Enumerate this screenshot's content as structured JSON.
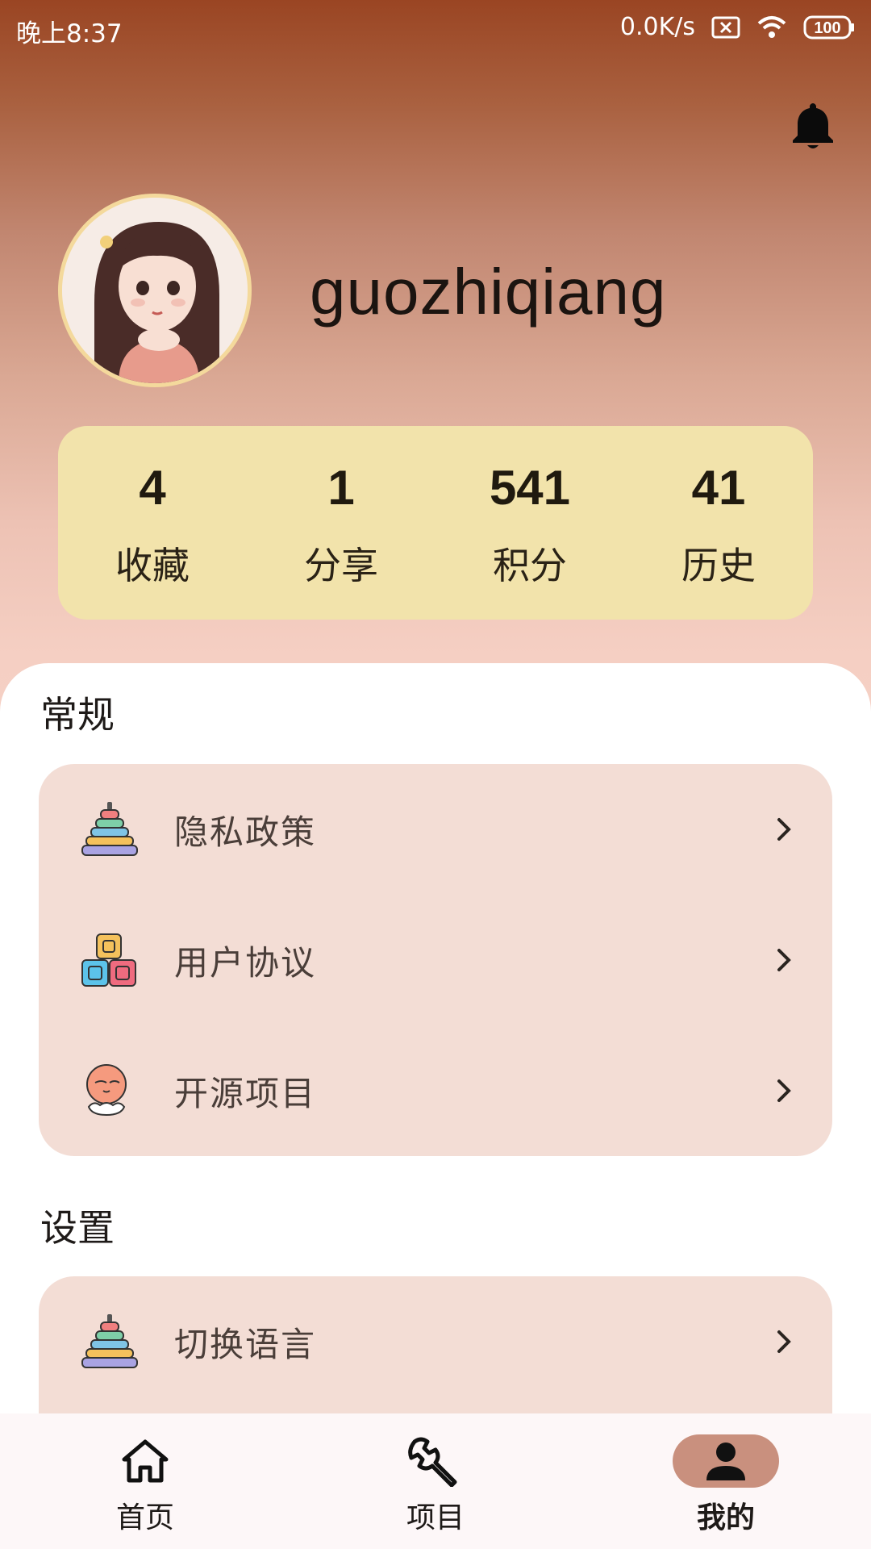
{
  "status_bar": {
    "time": "晚上8:37",
    "net_speed": "0.0K/s",
    "battery": "100"
  },
  "profile": {
    "username": "guozhiqiang",
    "stats": [
      {
        "value": "4",
        "label": "收藏"
      },
      {
        "value": "1",
        "label": "分享"
      },
      {
        "value": "541",
        "label": "积分"
      },
      {
        "value": "41",
        "label": "历史"
      }
    ]
  },
  "sections": {
    "general": {
      "title": "常规",
      "items": [
        {
          "label": "隐私政策",
          "icon": "stacking-rings-icon"
        },
        {
          "label": "用户协议",
          "icon": "blocks-icon"
        },
        {
          "label": "开源项目",
          "icon": "character-icon"
        }
      ]
    },
    "settings": {
      "title": "设置",
      "items": [
        {
          "label": "切换语言",
          "icon": "stacking-rings-icon"
        }
      ]
    }
  },
  "bottom_nav": {
    "items": [
      {
        "label": "首页",
        "icon": "home-icon"
      },
      {
        "label": "项目",
        "icon": "wrench-icon"
      },
      {
        "label": "我的",
        "icon": "person-icon"
      }
    ],
    "active": "我的"
  },
  "colors": {
    "header_top": "#9a4523",
    "stats_card": "#f2e3ab",
    "menu_card": "#f3ddd5",
    "nav_active": "#c9907e"
  }
}
